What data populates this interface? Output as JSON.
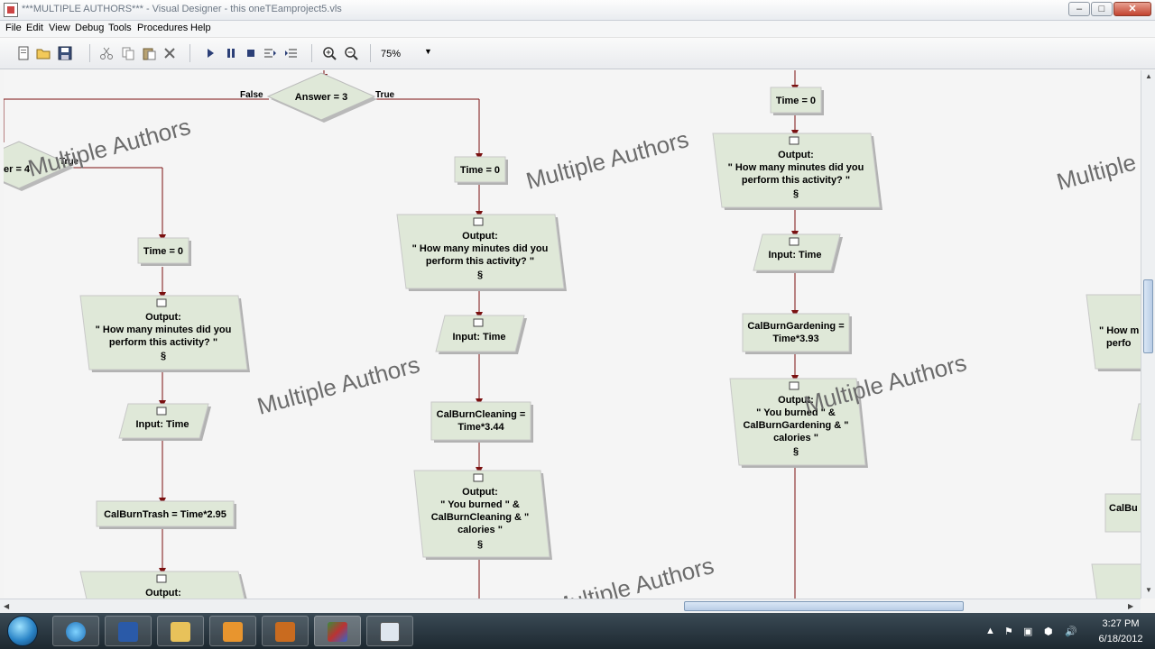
{
  "window": {
    "title": "***MULTIPLE AUTHORS*** - Visual Designer - this oneTEamproject5.vls",
    "minimize": "–",
    "maximize": "□",
    "close": "✕"
  },
  "menu": [
    "File",
    "Edit",
    "View",
    "Debug",
    "Tools",
    "Procedures",
    "Help"
  ],
  "toolbar": {
    "zoom": "75%",
    "icons": [
      "new-icon",
      "open-icon",
      "save-icon",
      "cut-icon",
      "copy-icon",
      "paste-icon",
      "delete-icon",
      "run-icon",
      "pause-icon",
      "stop-icon",
      "step-into-icon",
      "step-over-icon",
      "zoom-in-icon",
      "zoom-out-icon"
    ]
  },
  "watermark": "Multiple Authors",
  "flowchart": {
    "decision_main": "Answer = 3",
    "branch_false": "False",
    "branch_true": "True",
    "decision_left": "er = 4",
    "branch_true_left": "True",
    "symbol": "§",
    "left": {
      "assign_time": "Time = 0",
      "output_label": "Output:",
      "output_line1": "\" How many minutes did you",
      "output_line2": "perform this activity? \"",
      "input": "Input: Time",
      "calc": "CalBurnTrash = Time*2.95",
      "output2_label": "Output:"
    },
    "middle": {
      "assign_time": "Time = 0",
      "output_label": "Output:",
      "output_line1": "\" How many minutes did you",
      "output_line2": "perform this activity? \"",
      "input": "Input: Time",
      "calc_line1": "CalBurnCleaning =",
      "calc_line2": "Time*3.44",
      "output2_label": "Output:",
      "output2_line1": "\" You burned \" &",
      "output2_line2": "CalBurnCleaning & \"",
      "output2_line3": "calories \""
    },
    "right": {
      "assign_time": "Time = 0",
      "output_label": "Output:",
      "output_line1": "\" How many minutes did you",
      "output_line2": "perform this activity? \"",
      "input": "Input: Time",
      "calc_line1": "CalBurnGardening =",
      "calc_line2": "Time*3.93",
      "output2_label": "Output:",
      "output2_line1": "\" You burned \" &",
      "output2_line2": "CalBurnGardening & \"",
      "output2_line3": "calories \""
    },
    "far_right": {
      "output_line1": "\" How m",
      "output_line2": "perfo",
      "calc": "CalBu"
    }
  },
  "taskbar": {
    "apps": [
      "internet-explorer-icon",
      "word-icon",
      "file-explorer-icon",
      "outlook-icon",
      "media-player-icon",
      "visual-designer-icon",
      "window-icon"
    ],
    "time": "3:27 PM",
    "date": "6/18/2012"
  }
}
